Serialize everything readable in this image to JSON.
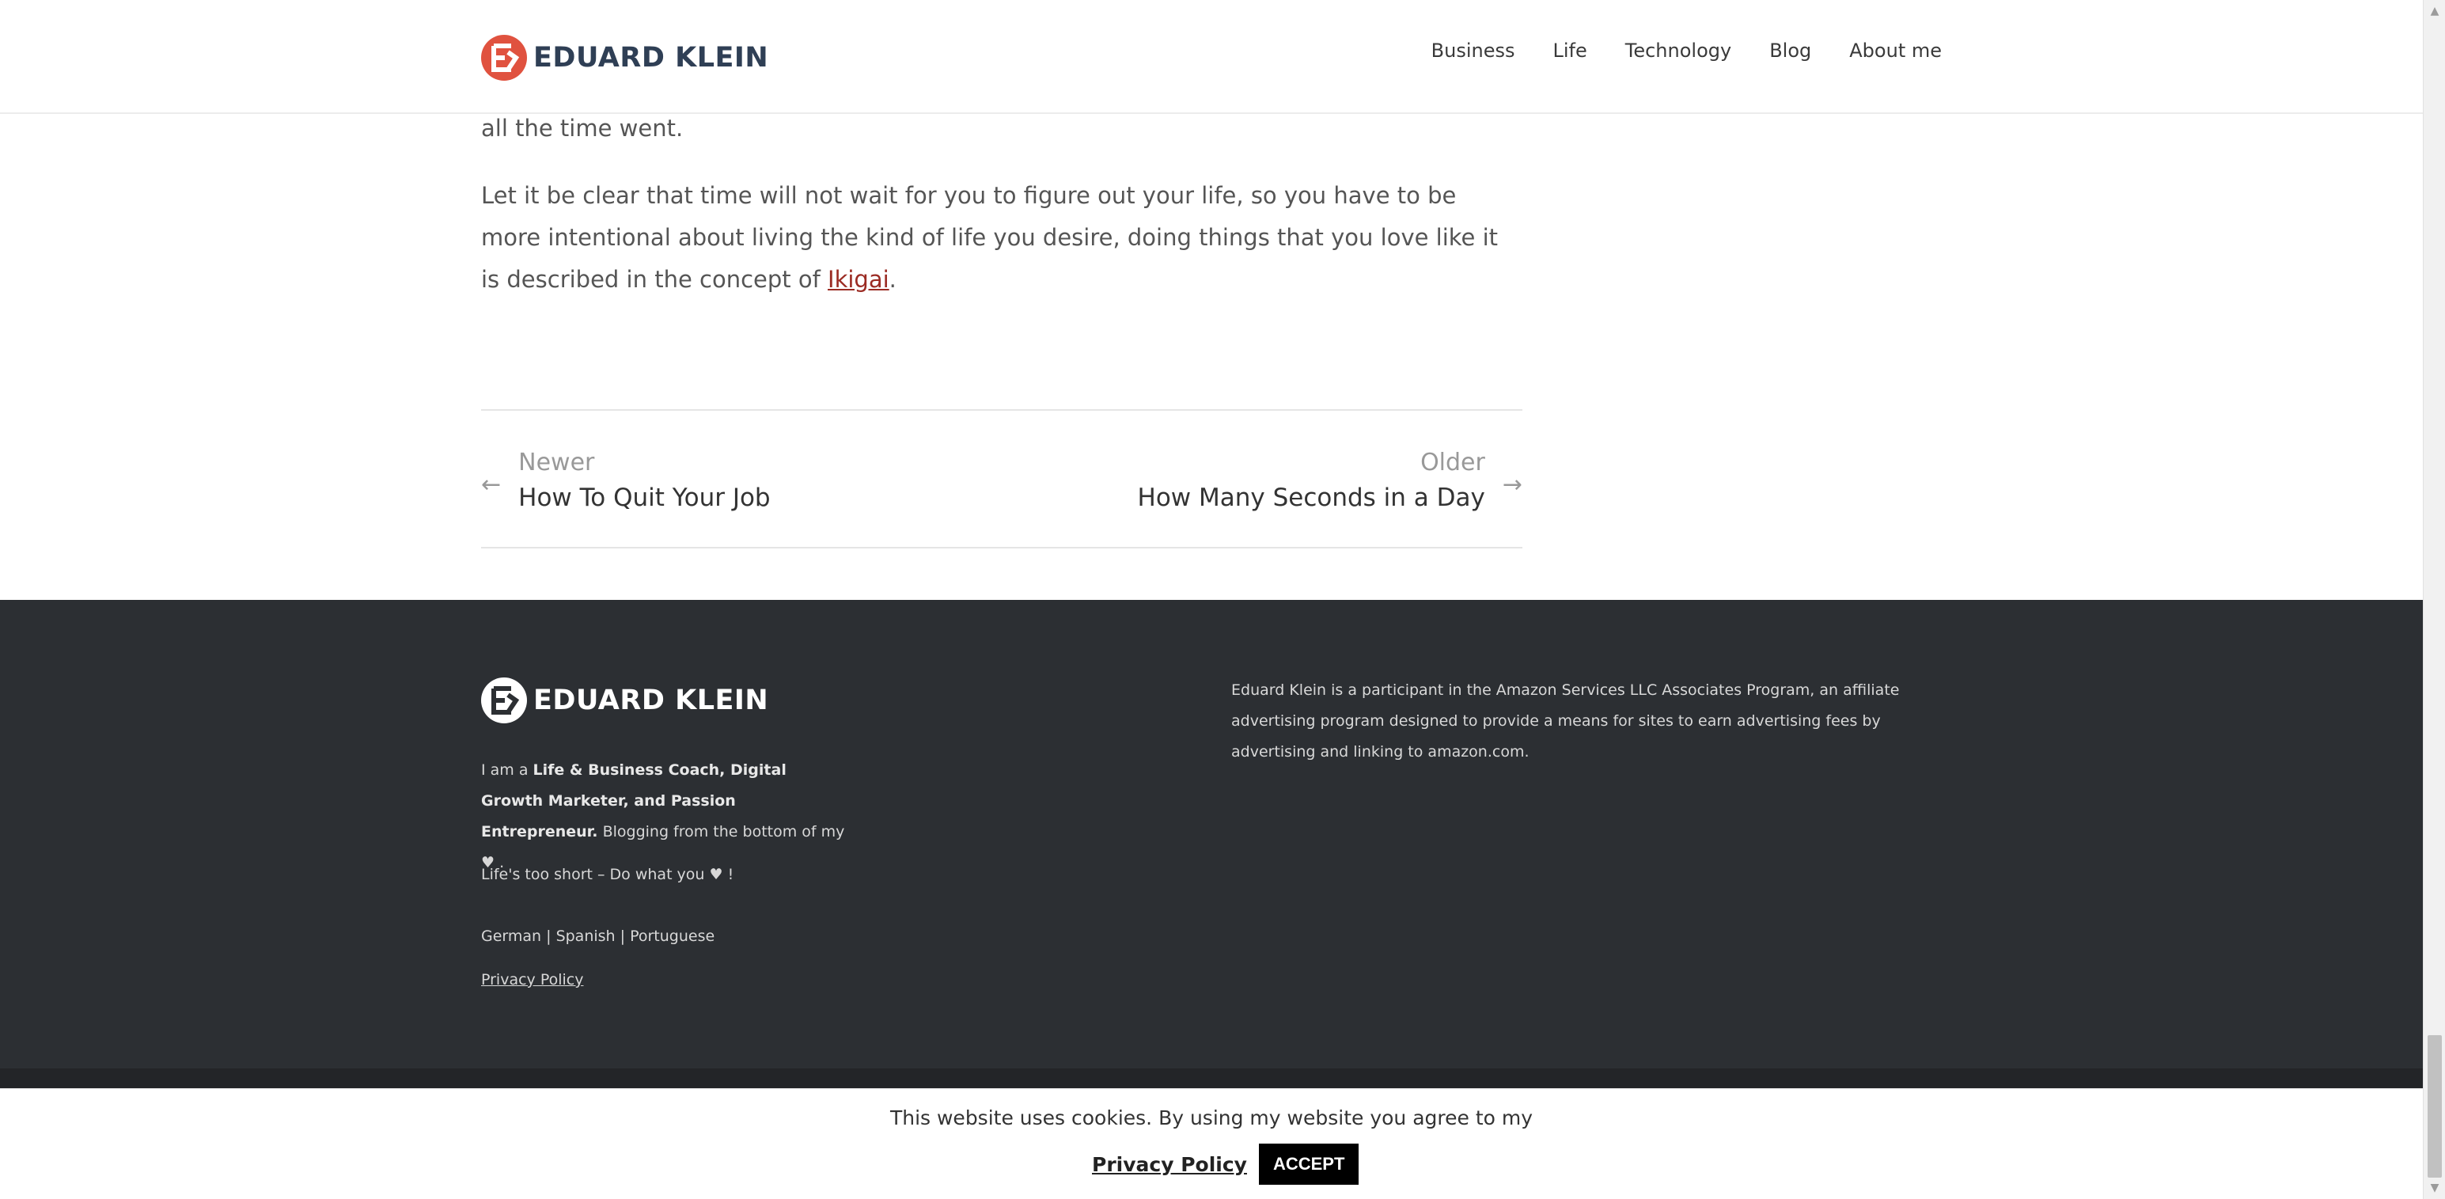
{
  "header": {
    "logo_text": "EDUARD KLEIN",
    "nav": [
      "Business",
      "Life",
      "Technology",
      "Blog",
      "About me"
    ]
  },
  "article": {
    "para1": "all the time went.",
    "para2_before": "Let it be clear that time will not wait for you to figure out your life, so you have to be more intentional about living the kind of life you desire, doing things that you love like it is described in the concept of ",
    "para2_link": "Ikigai",
    "para2_after": "."
  },
  "post_nav": {
    "newer_label": "Newer",
    "newer_title": "How To Quit Your Job",
    "older_label": "Older",
    "older_title": "How Many Seconds in a Day"
  },
  "footer": {
    "logo_text": "EDUARD KLEIN",
    "about_prefix": "I am a ",
    "about_bold": "Life & Business Coach, Digital Growth Marketer, and Passion Entrepreneur.",
    "about_suffix": " Blogging from the bottom of my ♥ .",
    "motto": "Life's too short – Do what you ♥ !",
    "languages": "German | Spanish | Portuguese",
    "privacy": "Privacy Policy",
    "amazon": "Eduard Klein is a participant in the Amazon Services LLC Associates Program, an affiliate advertising program designed to provide a means for sites to earn advertising fees by advertising and linking to amazon.com."
  },
  "cookie": {
    "message": "This website uses cookies. By using my website you agree to my",
    "link": "Privacy Policy",
    "accept": "ACCEPT"
  },
  "icons": {
    "nav_left": "arrow-left-icon",
    "nav_right": "arrow-right-icon"
  },
  "colors": {
    "brand_red": "#e0523f",
    "brand_navy": "#2f3f55",
    "footer_bg": "#2c2f33",
    "link": "#9b2b23"
  }
}
